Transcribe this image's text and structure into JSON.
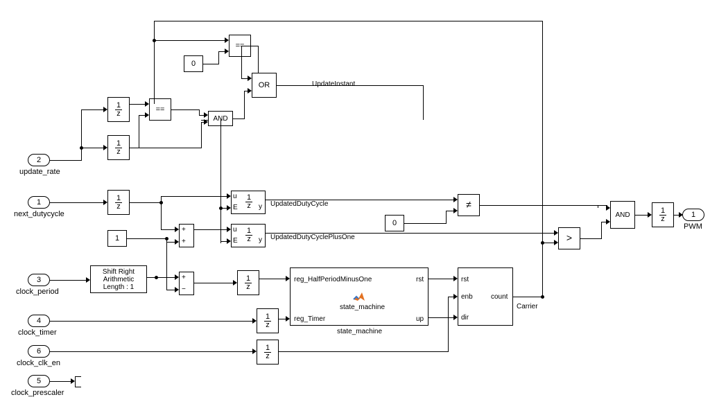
{
  "inputs": {
    "next_dutycycle": {
      "num": "1",
      "label": "next_dutycycle"
    },
    "update_rate": {
      "num": "2",
      "label": "update_rate"
    },
    "clock_period": {
      "num": "3",
      "label": "clock_period"
    },
    "clock_timer": {
      "num": "4",
      "label": "clock_timer"
    },
    "clock_prescaler": {
      "num": "5",
      "label": "clock_prescaler"
    },
    "clock_clk_en": {
      "num": "6",
      "label": "clock_clk_en"
    }
  },
  "outputs": {
    "pwm": {
      "num": "1",
      "label": "PWM"
    }
  },
  "const": {
    "zero1": "0",
    "zero2": "0",
    "one": "1"
  },
  "blocks": {
    "delay": {
      "num": "1",
      "den": "z"
    },
    "eq": "==",
    "or": "OR",
    "and": "AND",
    "ne": "≠",
    "gt": ">",
    "shift": "Shift Right\nArithmetic\nLength : 1",
    "enabledDelay": {
      "u": "u",
      "E": "E",
      "y": "y"
    },
    "sum_pp": {
      "top": "+",
      "bot": "+"
    },
    "sum_pm": {
      "top": "+",
      "bot": "−"
    },
    "state_machine": {
      "title": "state_machine",
      "sub": "state_machine",
      "p_in1": "reg_HalfPeriodMinusOne",
      "p_in2": "reg_Timer",
      "p_out1": "rst",
      "p_out2": "up"
    },
    "counter": {
      "p_rst": "rst",
      "p_enb": "enb",
      "p_dir": "dir",
      "p_out": "count",
      "label": "Carrier"
    }
  },
  "labels": {
    "UpdateInstant": "UpdateInstant",
    "UpdatedDutyCycle": "UpdatedDutyCycle",
    "UpdatedDutyCyclePlusOne": "UpdatedDutyCyclePlusOne"
  }
}
